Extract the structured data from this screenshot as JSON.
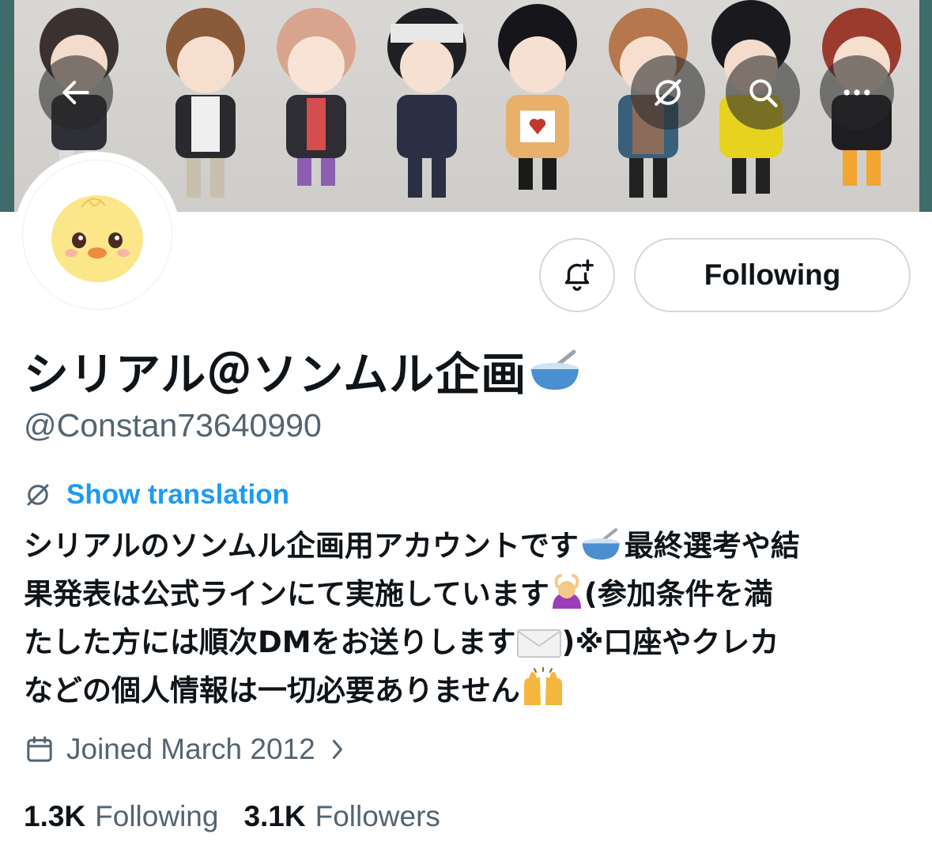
{
  "header": {
    "back_icon": "arrow-left-icon",
    "translate_icon": "translate-icon",
    "search_icon": "search-icon",
    "more_icon": "more-horizontal-icon"
  },
  "profile": {
    "display_name": "シリアル＠ソンムル企画",
    "name_emoji": "bowl-with-spoon",
    "handle": "@Constan73640990",
    "follow_button_label": "Following",
    "notify_icon": "bell-plus-icon"
  },
  "translation": {
    "label": "Show translation"
  },
  "bio": {
    "line1": "シリアルのソンムル企画用アカウントです",
    "line1b": "最終選考や結",
    "line2": "果発表は公式ラインにて実施しています",
    "line2b": "(参加条件を満",
    "line3": "たした方には順次DMをお送りします",
    "line3b": ")※口座やクレカ",
    "line4": "などの個人情報は一切必要ありません"
  },
  "joined": {
    "label": "Joined March 2012"
  },
  "stats": {
    "following_count": "1.3K",
    "following_label": "Following",
    "followers_count": "3.1K",
    "followers_label": "Followers"
  },
  "colors": {
    "accent": "#1d9bf0",
    "secondary_text": "#536471",
    "border": "#cfd9de"
  }
}
